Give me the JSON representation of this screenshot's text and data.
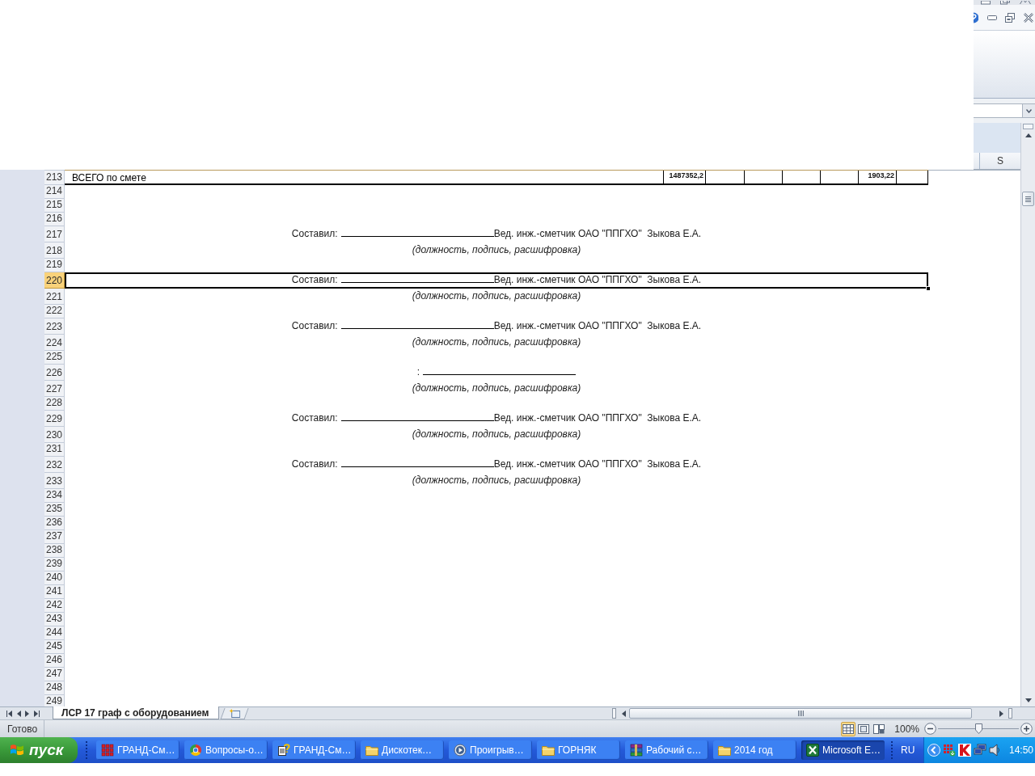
{
  "column_header": "S",
  "rows": [
    {
      "number": "213",
      "selected": false,
      "kind": "total",
      "label": "ВСЕГО по смете",
      "cells": [
        {
          "kind": "value",
          "value": "1487352,2"
        },
        {
          "kind": "blank"
        },
        {
          "kind": "blank"
        },
        {
          "kind": "blank"
        },
        {
          "kind": "blank"
        },
        {
          "kind": "value",
          "value": "1903,22"
        },
        {
          "kind": "blank"
        }
      ]
    },
    {
      "number": "214",
      "selected": false,
      "kind": "empty"
    },
    {
      "number": "215",
      "selected": false,
      "kind": "empty"
    },
    {
      "number": "216",
      "selected": false,
      "kind": "empty"
    },
    {
      "number": "217",
      "selected": false,
      "kind": "signature",
      "prefix": "Составил:",
      "signer": "Вед. инж.-сметчик ОАО \"ППГХО\"  Зыкова Е.А."
    },
    {
      "number": "218",
      "selected": false,
      "kind": "caption",
      "text": "(должность, подпись, расшифровка)"
    },
    {
      "number": "219",
      "selected": false,
      "kind": "empty"
    },
    {
      "number": "220",
      "selected": true,
      "kind": "signature",
      "prefix": "Составил:",
      "signer": "Вед. инж.-сметчик ОАО \"ППГХО\"  Зыкова Е.А."
    },
    {
      "number": "221",
      "selected": false,
      "kind": "caption",
      "text": "(должность, подпись, расшифровка)"
    },
    {
      "number": "222",
      "selected": false,
      "kind": "empty"
    },
    {
      "number": "223",
      "selected": false,
      "kind": "signature",
      "prefix": "Составил:",
      "signer": "Вед. инж.-сметчик ОАО \"ППГХО\"  Зыкова Е.А."
    },
    {
      "number": "224",
      "selected": false,
      "kind": "caption",
      "text": "(должность, подпись, расшифровка)"
    },
    {
      "number": "225",
      "selected": false,
      "kind": "empty"
    },
    {
      "number": "226",
      "selected": false,
      "kind": "signature",
      "prefix": ":"
    },
    {
      "number": "227",
      "selected": false,
      "kind": "caption",
      "text": "(должность, подпись, расшифровка)"
    },
    {
      "number": "228",
      "selected": false,
      "kind": "empty"
    },
    {
      "number": "229",
      "selected": false,
      "kind": "signature",
      "prefix": "Составил:",
      "signer": "Вед. инж.-сметчик ОАО \"ППГХО\"  Зыкова Е.А."
    },
    {
      "number": "230",
      "selected": false,
      "kind": "caption",
      "text": "(должность, подпись, расшифровка)"
    },
    {
      "number": "231",
      "selected": false,
      "kind": "empty"
    },
    {
      "number": "232",
      "selected": false,
      "kind": "signature",
      "prefix": "Составил:",
      "signer": "Вед. инж.-сметчик ОАО \"ППГХО\"  Зыкова Е.А."
    },
    {
      "number": "233",
      "selected": false,
      "kind": "caption",
      "text": "(должность, подпись, расшифровка)"
    },
    {
      "number": "234",
      "selected": false,
      "kind": "empty"
    },
    {
      "number": "235",
      "selected": false,
      "kind": "empty"
    },
    {
      "number": "236",
      "selected": false,
      "kind": "empty"
    },
    {
      "number": "237",
      "selected": false,
      "kind": "empty"
    },
    {
      "number": "238",
      "selected": false,
      "kind": "empty"
    },
    {
      "number": "239",
      "selected": false,
      "kind": "empty"
    },
    {
      "number": "240",
      "selected": false,
      "kind": "empty"
    },
    {
      "number": "241",
      "selected": false,
      "kind": "empty"
    },
    {
      "number": "242",
      "selected": false,
      "kind": "empty"
    },
    {
      "number": "243",
      "selected": false,
      "kind": "empty"
    },
    {
      "number": "244",
      "selected": false,
      "kind": "empty"
    },
    {
      "number": "245",
      "selected": false,
      "kind": "empty"
    },
    {
      "number": "246",
      "selected": false,
      "kind": "empty"
    },
    {
      "number": "247",
      "selected": false,
      "kind": "empty"
    },
    {
      "number": "248",
      "selected": false,
      "kind": "empty"
    },
    {
      "number": "249",
      "selected": false,
      "kind": "empty"
    }
  ],
  "sheet_tabs": [
    {
      "label": "ЛСР 17 граф с оборудованием",
      "selected": true
    }
  ],
  "status_bar": {
    "status": "Готово",
    "views": [
      {
        "kind": "normal",
        "selected": true
      },
      {
        "kind": "page_layout",
        "selected": false
      },
      {
        "kind": "page_break",
        "selected": false
      }
    ],
    "zoom": "100%",
    "zoom_slider": {
      "level": 0.5
    }
  },
  "taskbar": {
    "start_button": "пуск",
    "items": [
      {
        "kind": "grid",
        "label": "ГРАНД-См…",
        "selected": false
      },
      {
        "kind": "browser",
        "label": "Вопросы-о…",
        "selected": false
      },
      {
        "kind": "help",
        "label": "ГРАНД-См…",
        "selected": false
      },
      {
        "kind": "folder",
        "label": "Дискотек…",
        "selected": false
      },
      {
        "kind": "player",
        "label": "Проигрыв…",
        "selected": false
      },
      {
        "kind": "folder",
        "label": "ГОРНЯК",
        "selected": false
      },
      {
        "kind": "archive",
        "label": "Рабочий с…",
        "selected": false
      },
      {
        "kind": "folder",
        "label": "2014 год",
        "selected": false
      },
      {
        "kind": "spreadsheet",
        "label": "Microsoft E…",
        "selected": true
      }
    ],
    "language": "RU",
    "clock": "14:50"
  }
}
